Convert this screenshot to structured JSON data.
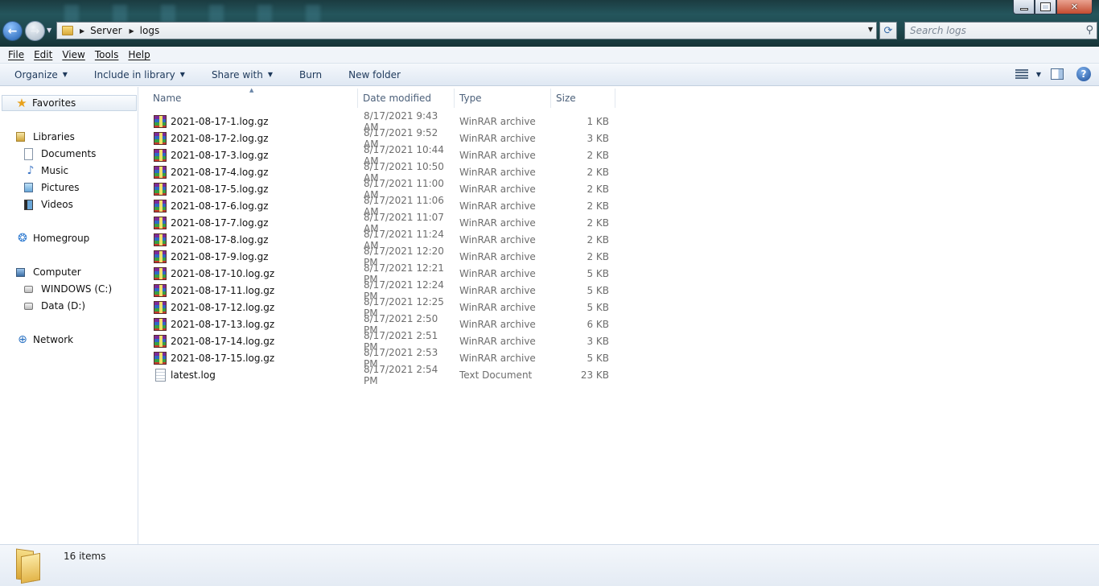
{
  "window": {
    "address": {
      "crumbs": [
        "Server",
        "logs"
      ]
    },
    "search": {
      "placeholder": "Search logs"
    }
  },
  "menu": [
    "File",
    "Edit",
    "View",
    "Tools",
    "Help"
  ],
  "toolbar": {
    "organize": "Organize",
    "include_in_library": "Include in library",
    "share_with": "Share with",
    "burn": "Burn",
    "new_folder": "New folder"
  },
  "nav": {
    "favorites": "Favorites",
    "libraries": "Libraries",
    "documents": "Documents",
    "music": "Music",
    "pictures": "Pictures",
    "videos": "Videos",
    "homegroup": "Homegroup",
    "computer": "Computer",
    "windows_c": "WINDOWS (C:)",
    "data_d": "Data (D:)",
    "network": "Network"
  },
  "columns": {
    "name": "Name",
    "date": "Date modified",
    "type": "Type",
    "size": "Size"
  },
  "files": [
    {
      "name": "2021-08-17-1.log.gz",
      "date": "8/17/2021 9:43 AM",
      "type": "WinRAR archive",
      "size": "1 KB",
      "icon": "winrar-icon"
    },
    {
      "name": "2021-08-17-2.log.gz",
      "date": "8/17/2021 9:52 AM",
      "type": "WinRAR archive",
      "size": "3 KB",
      "icon": "winrar-icon"
    },
    {
      "name": "2021-08-17-3.log.gz",
      "date": "8/17/2021 10:44 AM",
      "type": "WinRAR archive",
      "size": "2 KB",
      "icon": "winrar-icon"
    },
    {
      "name": "2021-08-17-4.log.gz",
      "date": "8/17/2021 10:50 AM",
      "type": "WinRAR archive",
      "size": "2 KB",
      "icon": "winrar-icon"
    },
    {
      "name": "2021-08-17-5.log.gz",
      "date": "8/17/2021 11:00 AM",
      "type": "WinRAR archive",
      "size": "2 KB",
      "icon": "winrar-icon"
    },
    {
      "name": "2021-08-17-6.log.gz",
      "date": "8/17/2021 11:06 AM",
      "type": "WinRAR archive",
      "size": "2 KB",
      "icon": "winrar-icon"
    },
    {
      "name": "2021-08-17-7.log.gz",
      "date": "8/17/2021 11:07 AM",
      "type": "WinRAR archive",
      "size": "2 KB",
      "icon": "winrar-icon"
    },
    {
      "name": "2021-08-17-8.log.gz",
      "date": "8/17/2021 11:24 AM",
      "type": "WinRAR archive",
      "size": "2 KB",
      "icon": "winrar-icon"
    },
    {
      "name": "2021-08-17-9.log.gz",
      "date": "8/17/2021 12:20 PM",
      "type": "WinRAR archive",
      "size": "2 KB",
      "icon": "winrar-icon"
    },
    {
      "name": "2021-08-17-10.log.gz",
      "date": "8/17/2021 12:21 PM",
      "type": "WinRAR archive",
      "size": "5 KB",
      "icon": "winrar-icon"
    },
    {
      "name": "2021-08-17-11.log.gz",
      "date": "8/17/2021 12:24 PM",
      "type": "WinRAR archive",
      "size": "5 KB",
      "icon": "winrar-icon"
    },
    {
      "name": "2021-08-17-12.log.gz",
      "date": "8/17/2021 12:25 PM",
      "type": "WinRAR archive",
      "size": "5 KB",
      "icon": "winrar-icon"
    },
    {
      "name": "2021-08-17-13.log.gz",
      "date": "8/17/2021 2:50 PM",
      "type": "WinRAR archive",
      "size": "6 KB",
      "icon": "winrar-icon"
    },
    {
      "name": "2021-08-17-14.log.gz",
      "date": "8/17/2021 2:51 PM",
      "type": "WinRAR archive",
      "size": "3 KB",
      "icon": "winrar-icon"
    },
    {
      "name": "2021-08-17-15.log.gz",
      "date": "8/17/2021 2:53 PM",
      "type": "WinRAR archive",
      "size": "5 KB",
      "icon": "winrar-icon"
    },
    {
      "name": "latest.log",
      "date": "8/17/2021 2:54 PM",
      "type": "Text Document",
      "size": "23 KB",
      "icon": "text-file-icon"
    }
  ],
  "status": {
    "item_count": "16 items"
  }
}
